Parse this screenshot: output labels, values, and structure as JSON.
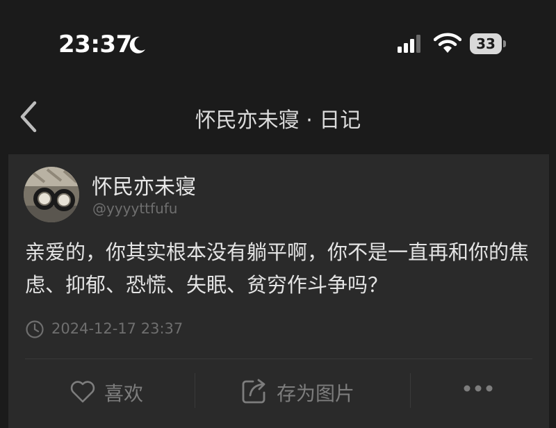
{
  "status_bar": {
    "time": "23:37",
    "battery": "33",
    "icons": [
      "moon-icon",
      "signal-icon",
      "wifi-icon",
      "battery-icon"
    ]
  },
  "nav": {
    "title": "怀民亦未寝 · 日记",
    "back_icon": "chevron-left-icon"
  },
  "post": {
    "author_name": "怀民亦未寝",
    "author_handle": "@yyyyttfufu",
    "body": "亲爱的，你其实根本没有躺平啊，你不是一直再和你的焦虑、抑郁、恐慌、失眠、贫穷作斗争吗？",
    "timestamp": "2024-12-17 23:37"
  },
  "actions": {
    "like_label": "喜欢",
    "save_label": "存为图片",
    "more_icon": "more-dots-icon"
  },
  "colors": {
    "background": "#1b1b1b",
    "card": "#2a2a2a",
    "text_primary": "#e4e4e4",
    "text_secondary": "#6f6f6f"
  }
}
